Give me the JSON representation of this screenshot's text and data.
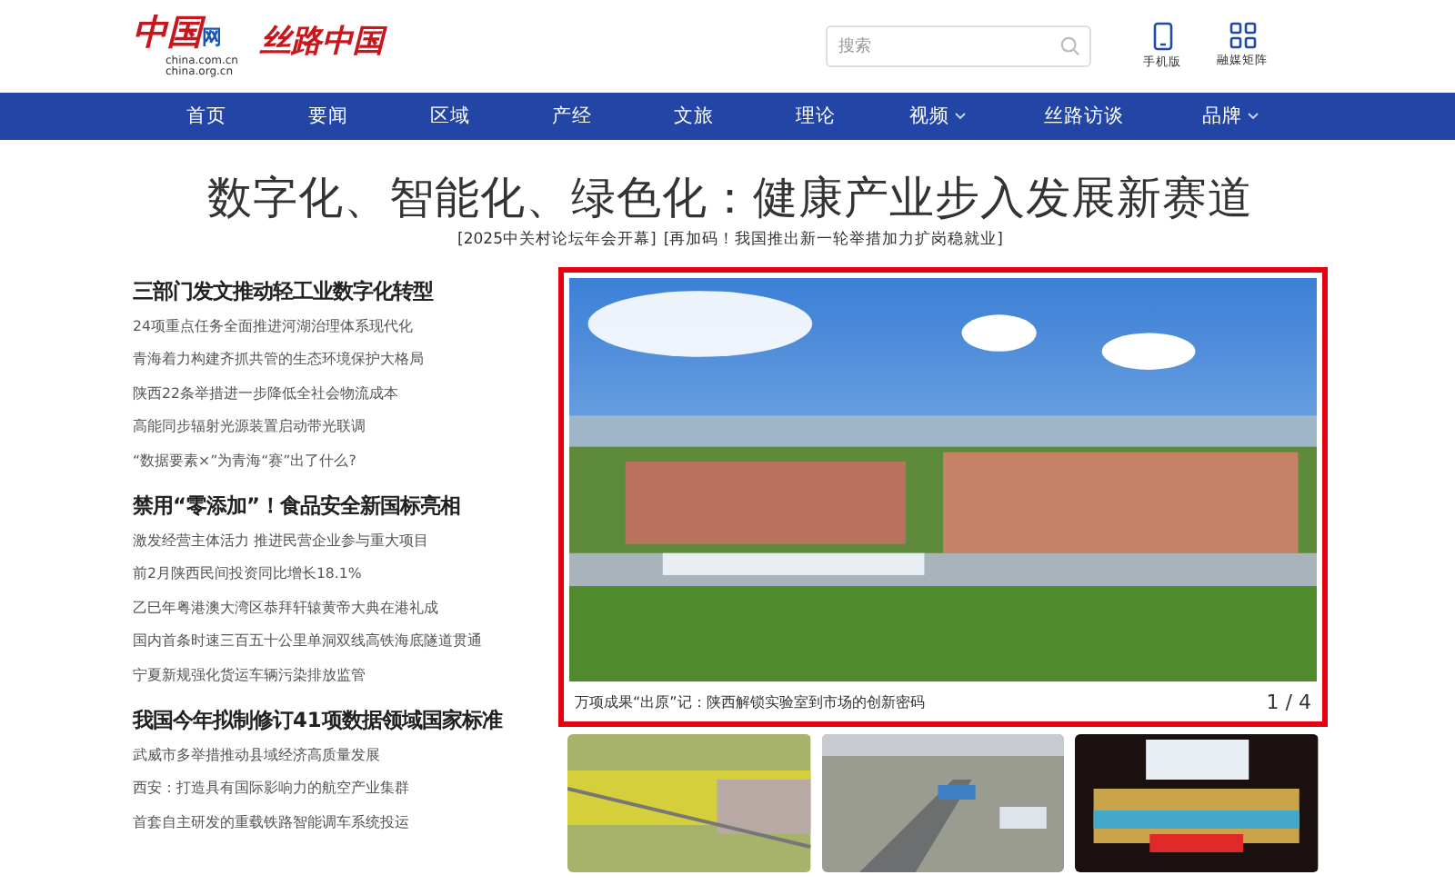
{
  "header": {
    "logo": {
      "mark": "中国",
      "mark_suffix": "网",
      "domains": [
        "china.com.cn",
        "china.org.cn"
      ]
    },
    "brand": "丝路中国",
    "search": {
      "placeholder": "搜索"
    },
    "shortcuts": [
      {
        "kind": "phone",
        "label": "手机版"
      },
      {
        "kind": "grid",
        "label": "融媒矩阵"
      }
    ]
  },
  "nav": [
    {
      "label": "首页",
      "dropdown": false
    },
    {
      "label": "要闻",
      "dropdown": false
    },
    {
      "label": "区域",
      "dropdown": false
    },
    {
      "label": "产经",
      "dropdown": false
    },
    {
      "label": "文旅",
      "dropdown": false
    },
    {
      "label": "理论",
      "dropdown": false
    },
    {
      "label": "视频",
      "dropdown": true
    },
    {
      "label": "丝路访谈",
      "dropdown": false
    },
    {
      "label": "品牌",
      "dropdown": true
    }
  ],
  "headline": {
    "title": "数字化、智能化、绿色化：健康产业步入发展新赛道",
    "links": [
      "[2025中关村论坛年会开幕]",
      "[再加码！我国推出新一轮举措加力扩岗稳就业]"
    ]
  },
  "news_groups": [
    {
      "title": "三部门发文推动轻工业数字化转型",
      "items": [
        "24项重点任务全面推进河湖治理体系现代化",
        "青海着力构建齐抓共管的生态环境保护大格局",
        "陕西22条举措进一步降低全社会物流成本",
        "高能同步辐射光源装置启动带光联调",
        "“数据要素×”为青海“赛”出了什么?"
      ]
    },
    {
      "title": "禁用“零添加”！食品安全新国标亮相",
      "items": [
        "激发经营主体活力 推进民营企业参与重大项目",
        "前2月陕西民间投资同比增长18.1%",
        "乙巳年粤港澳大湾区恭拜轩辕黄帝大典在港礼成",
        "国内首条时速三百五十公里单洞双线高铁海底隧道贯通",
        "宁夏新规强化货运车辆污染排放监管"
      ]
    },
    {
      "title": "我国今年拟制修订41项数据领域国家标准",
      "items": [
        "武威市多举措推动县域经济高质量发展",
        "西安：打造具有国际影响力的航空产业集群",
        "首套自主研发的重载铁路智能调车系统投运"
      ]
    }
  ],
  "slideshow": {
    "caption": "万项成果“出原”记：陕西解锁实验室到市场的创新密码",
    "counter": "1 / 4"
  },
  "thumbnails": [
    {
      "kind": "fields"
    },
    {
      "kind": "railway"
    },
    {
      "kind": "stage"
    }
  ]
}
